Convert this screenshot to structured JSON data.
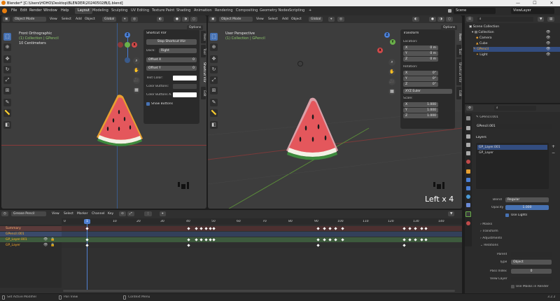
{
  "window": {
    "title": "Blender* [C:\\Users\\HOHO\\Desktop\\BLENDER\\20240502西瓜.blend]",
    "minimize": "—",
    "maximize": "☐",
    "close": "✕"
  },
  "topbar": {
    "menus": [
      "File",
      "Edit",
      "Render",
      "Window",
      "Help"
    ],
    "workspaces": [
      "Layout",
      "Modeling",
      "Sculpting",
      "UV Editing",
      "Texture Paint",
      "Shading",
      "Animation",
      "Rendering",
      "Compositing",
      "Geometry Nodes",
      "Scripting"
    ],
    "active_workspace": "Layout",
    "scene": "Scene",
    "view_layer": "ViewLayer"
  },
  "left_view": {
    "mode": "Object Mode",
    "menus": [
      "View",
      "Select",
      "Add",
      "Object"
    ],
    "transform": "Global",
    "overlay_title": "Front Orthographic",
    "overlay_collection": "(1) Collection | GPencil",
    "overlay_scale": "10 Centimeters",
    "options": "Options",
    "tabs": [
      "Item",
      "Tool",
      "Shortcut VUr",
      "Edit"
    ]
  },
  "shortcut_panel": {
    "header": "Shortcut VUr",
    "stop_button": "Stop Shortcut VUr",
    "dock_label": "Dock:",
    "dock_value": "Right",
    "offset_x_label": "Offset X",
    "offset_x_value": "0",
    "offset_y_label": "Offset Y",
    "offset_y_value": "0",
    "text_color_label": "Text Color:",
    "color_buttons_label": "Color Buttons:",
    "color_buttons_a_label": "Color Buttons A...",
    "show_buttons_label": "Show Buttons"
  },
  "right_view": {
    "mode": "Object Mode",
    "menus": [
      "View",
      "Select",
      "Add",
      "Object"
    ],
    "transform": "Global",
    "overlay_title": "User Perspective",
    "overlay_collection": "(1) Collection | GPencil",
    "options": "Options",
    "screencast_text": "Left x 4",
    "tabs": [
      "Item",
      "Tool",
      "Shortcut VUr",
      "Edit"
    ]
  },
  "transform_panel": {
    "header": "Transform",
    "location_label": "Location:",
    "location": [
      {
        "axis": "X",
        "value": "0 m"
      },
      {
        "axis": "Y",
        "value": "0 m"
      },
      {
        "axis": "Z",
        "value": "0 m"
      }
    ],
    "rotation_label": "Rotation:",
    "rotation": [
      {
        "axis": "X",
        "value": "0°"
      },
      {
        "axis": "Y",
        "value": "0°"
      },
      {
        "axis": "Z",
        "value": "0°"
      }
    ],
    "rotation_mode": "XYZ Euler",
    "scale_label": "Scale:",
    "scale": [
      {
        "axis": "X",
        "value": "1.000"
      },
      {
        "axis": "Y",
        "value": "1.000"
      },
      {
        "axis": "Z",
        "value": "1.000"
      }
    ]
  },
  "outliner": {
    "items": [
      {
        "label": "Scene Collection"
      },
      {
        "label": "Collection"
      },
      {
        "label": "Camera"
      },
      {
        "label": "Cube"
      },
      {
        "label": "GPencil"
      },
      {
        "label": "Light"
      }
    ]
  },
  "properties": {
    "object_name": "GPencil.001",
    "datablock": "GPencil.001",
    "layers_header": "Layers",
    "layers": [
      "GP_Layer.001",
      "GP_Layer"
    ],
    "blend_label": "Blend",
    "blend_value": "Regular",
    "opacity_label": "Opacity",
    "opacity_value": "1.000",
    "use_lights": "Use Lights",
    "sections": [
      "Masks",
      "Transform",
      "Adjustments",
      "Relations"
    ],
    "parent_label": "Parent",
    "type_label": "Type",
    "type_value": "Object",
    "pass_index_label": "Pass Index",
    "pass_index_value": "0",
    "view_layer_label": "View Layer",
    "use_masks_render": "Use Masks in Render"
  },
  "dopesheet": {
    "mode": "Grease Pencil",
    "menus": [
      "View",
      "Select",
      "Marker",
      "Channel",
      "Key"
    ],
    "current_frame": "1",
    "frame_labels": [
      "0",
      "10",
      "20",
      "30",
      "40",
      "50",
      "60",
      "70",
      "80",
      "90",
      "100",
      "110",
      "120",
      "130",
      "140"
    ],
    "channels": [
      "Summary",
      "GPencil.001",
      "GP_Layer.001",
      "GP_Layer"
    ]
  },
  "status": {
    "left": "Set Active Modifier",
    "middle": "Pan View",
    "right": "Context Menu",
    "version": "3.2.2"
  },
  "colors": {
    "accent": "#4772b3",
    "selected_text": "#ffaf29",
    "timeline_blue": "#4f7fd0"
  }
}
